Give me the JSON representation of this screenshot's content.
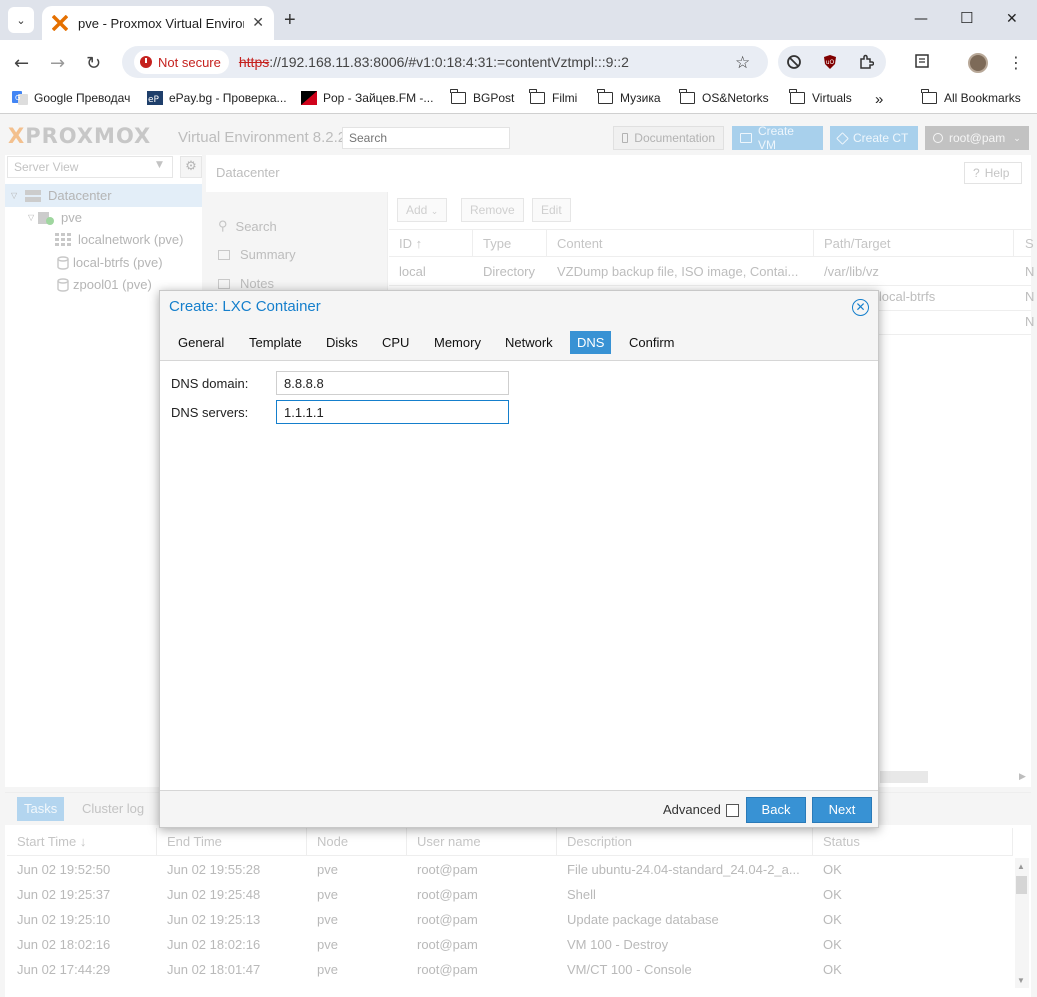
{
  "browser": {
    "tab_title": "pve - Proxmox Virtual Environment",
    "new_tab": "+",
    "not_secure": "Not secure",
    "url_scheme": "https",
    "url_rest": "://192.168.11.83:8006/#v1:0:18:4:31:=contentVztmpl:::9::2",
    "bookmarks": [
      "Google Преводач",
      "ePay.bg - Проверка...",
      "Pop - Зайцев.FM -...",
      "BGPost",
      "Filmi",
      "Музика",
      "OS&Netorks",
      "Virtuals"
    ],
    "bookmarks_more": "»",
    "all_bookmarks": "All Bookmarks"
  },
  "header": {
    "logo_x": "X",
    "logo_text": "PROXMOX",
    "version": "Virtual Environment 8.2.2",
    "search_placeholder": "Search",
    "documentation": "Documentation",
    "create_vm": "Create VM",
    "create_ct": "Create CT",
    "user": "root@pam"
  },
  "tree": {
    "view": "Server View",
    "items": [
      "Datacenter",
      "pve",
      "localnetwork (pve)",
      "local-btrfs (pve)",
      "zpool01 (pve)"
    ]
  },
  "main": {
    "title": "Datacenter",
    "help": "Help",
    "nav": [
      "Search",
      "Summary",
      "Notes"
    ],
    "toolbar": [
      "Add",
      "Remove",
      "Edit"
    ],
    "columns": [
      "ID",
      "Type",
      "Content",
      "Path/Target",
      "S"
    ],
    "rows": [
      {
        "id": "local",
        "type": "Directory",
        "content": "VZDump backup file, ISO image, Contai...",
        "path": "/var/lib/vz",
        "s": "N"
      },
      {
        "id": "",
        "type": "",
        "content": "",
        "path": "e/local-btrfs",
        "s": "N"
      },
      {
        "id": "",
        "type": "",
        "content": "",
        "path": "",
        "s": "N"
      }
    ]
  },
  "tasks": {
    "tabs": [
      "Tasks",
      "Cluster log"
    ],
    "columns": [
      "Start Time",
      "End Time",
      "Node",
      "User name",
      "Description",
      "Status"
    ],
    "rows": [
      {
        "start": "Jun 02 19:52:50",
        "end": "Jun 02 19:55:28",
        "node": "pve",
        "user": "root@pam",
        "desc": "File ubuntu-24.04-standard_24.04-2_a...",
        "status": "OK"
      },
      {
        "start": "Jun 02 19:25:37",
        "end": "Jun 02 19:25:48",
        "node": "pve",
        "user": "root@pam",
        "desc": "Shell",
        "status": "OK"
      },
      {
        "start": "Jun 02 19:25:10",
        "end": "Jun 02 19:25:13",
        "node": "pve",
        "user": "root@pam",
        "desc": "Update package database",
        "status": "OK"
      },
      {
        "start": "Jun 02 18:02:16",
        "end": "Jun 02 18:02:16",
        "node": "pve",
        "user": "root@pam",
        "desc": "VM 100 - Destroy",
        "status": "OK"
      },
      {
        "start": "Jun 02 17:44:29",
        "end": "Jun 02 18:01:47",
        "node": "pve",
        "user": "root@pam",
        "desc": "VM/CT 100 - Console",
        "status": "OK"
      }
    ]
  },
  "modal": {
    "title": "Create: LXC Container",
    "tabs": [
      "General",
      "Template",
      "Disks",
      "CPU",
      "Memory",
      "Network",
      "DNS",
      "Confirm"
    ],
    "active_tab": "DNS",
    "dns_domain_label": "DNS domain:",
    "dns_domain_value": "8.8.8.8",
    "dns_servers_label": "DNS servers:",
    "dns_servers_value": "1.1.1.1",
    "advanced": "Advanced",
    "back": "Back",
    "next": "Next"
  },
  "colors": {
    "accent": "#3892d4",
    "title_blue": "#157fcc",
    "not_secure_red": "#c5221f"
  }
}
